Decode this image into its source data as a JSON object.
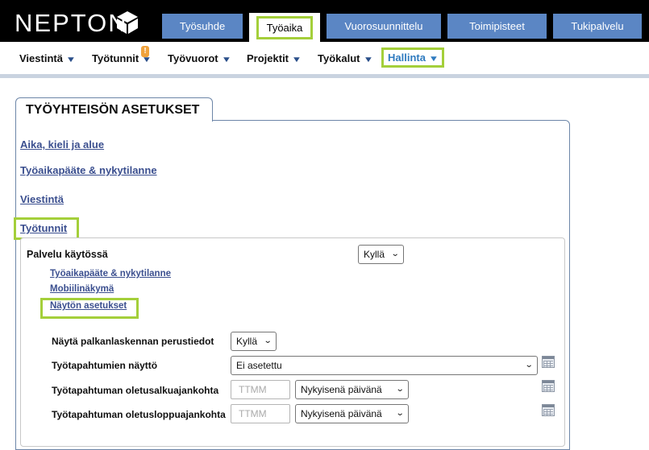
{
  "brand": {
    "name": "NEPTON",
    "logo_icon": "cube-logo-icon"
  },
  "top_tabs": [
    {
      "label": "Työsuhde"
    },
    {
      "label": "Työaika",
      "active": true
    },
    {
      "label": "Vuorosuunnittelu"
    },
    {
      "label": "Toimipisteet"
    },
    {
      "label": "Tukipalvelu"
    }
  ],
  "sub_nav": [
    {
      "label": "Viestintä"
    },
    {
      "label": "Työtunnit",
      "badge": "!"
    },
    {
      "label": "Työvuorot"
    },
    {
      "label": "Projektit"
    },
    {
      "label": "Työkalut"
    },
    {
      "label": "Hallinta",
      "active": true
    }
  ],
  "page": {
    "title": "TYÖYHTEISÖN ASETUKSET",
    "sections": [
      {
        "label": "Aika, kieli ja alue"
      },
      {
        "label": "Työaikapääte & nykytilanne"
      },
      {
        "label": "Viestintä"
      },
      {
        "label": "Työtunnit",
        "expanded": true
      }
    ]
  },
  "tyotunnit": {
    "service_label": "Palvelu käytössä",
    "service_value": "Kyllä",
    "sublinks": [
      {
        "label": "Työaikapääte & nykytilanne"
      },
      {
        "label": "Mobiilinäkymä"
      },
      {
        "label": "Näytön asetukset"
      }
    ],
    "settings": {
      "show_payroll_label": "Näytä palkanlaskennan perustiedot",
      "show_payroll_value": "Kyllä",
      "event_display_label": "Työtapahtumien näyttö",
      "event_display_value": "Ei asetettu",
      "default_start_label": "Työtapahtuman oletusalkuajankohta",
      "default_start_placeholder": "TTMM",
      "default_start_day": "Nykyisenä päivänä",
      "default_end_label": "Työtapahtuman oletusloppuajankohta",
      "default_end_placeholder": "TTMM",
      "default_end_day": "Nykyisenä päivänä"
    }
  },
  "colors": {
    "accent_highlight": "#a4cf3a",
    "tab_blue": "#5b86c4",
    "link_blue": "#3b4f8f"
  }
}
